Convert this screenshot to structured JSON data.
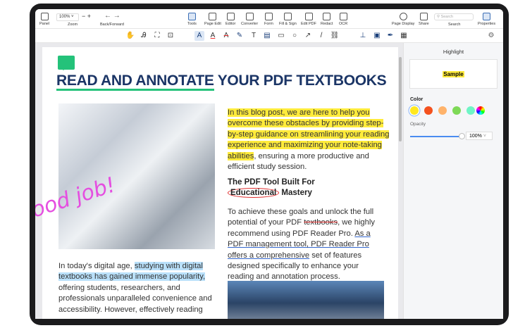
{
  "toolbar": {
    "panel": "Panel",
    "zoom_value": "100%",
    "zoom": "Zoom",
    "back_forward": "Back/Forward",
    "tools": [
      "Tools",
      "Page Edit",
      "Editor",
      "Converter",
      "Form",
      "Fill & Sign",
      "Edit PDF",
      "Redact",
      "OCR"
    ],
    "page_display": "Page Display",
    "share": "Share",
    "search_placeholder": "Search",
    "search": "Search",
    "properties": "Properties"
  },
  "annot_tools": [
    "hand-icon",
    "select-text-icon",
    "area-select-icon",
    "zoom-select-icon",
    "highlight-icon",
    "underline-icon",
    "strikethrough-icon",
    "pen-icon",
    "text-icon",
    "note-icon",
    "rectangle-icon",
    "circle-icon",
    "arrow-icon",
    "line-icon",
    "link-icon",
    "stamp-icon",
    "image-icon",
    "signature-icon",
    "table-icon",
    "gear-icon"
  ],
  "panel": {
    "title": "Highlight",
    "sample": "Sample",
    "color_label": "Color",
    "colors": [
      "#ffe81f",
      "#f4511e",
      "#ffb36b",
      "#7ed957",
      "#6ff5c6"
    ],
    "opacity_label": "Opacity",
    "opacity": "100%"
  },
  "doc": {
    "title_a": "READ AND ANNOTATE",
    "title_b": " YOUR PDF TEXTBOOKS",
    "p1_hl": "In this blog post, we are here to help you overcome these obstacles by providing step-by-step guidance on streamlining your reading experience and maximizing your note-taking abilities",
    "p1_rest": ", ensuring a more productive and efficient study session.",
    "h_a": "The PDF Tool Built For ",
    "h_b": "Educational",
    "h_c": " Mastery",
    "p2_a": "To achieve these goals and unlock the full potential of your PDF ",
    "p2_strike": "textbooks",
    "p2_b": ", we highly recommend using PDF Reader Pro. ",
    "p2_ul": "As a PDF management tool, PDF Reader Pro offers a comprehensive",
    "p2_c": " set of features designed specifically to enhance your reading and annotation process.",
    "p3_a": "In today's digital age, ",
    "p3_hl": "studying with digital textbooks has gained immense popularity,",
    "p3_b": " offering students, researchers, and professionals unparalleled convenience and accessibility. However, effectively reading",
    "handwriting": "Good job!"
  }
}
